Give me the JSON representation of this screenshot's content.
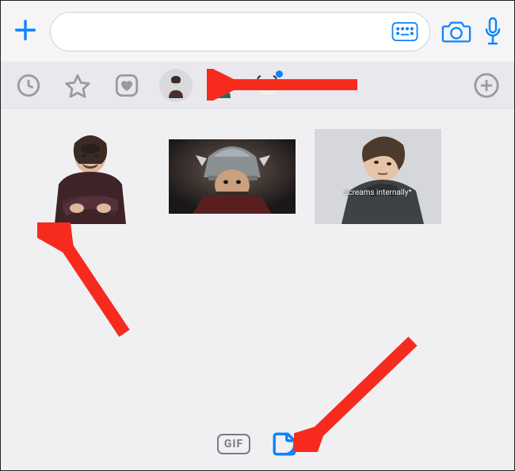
{
  "compose": {
    "plus_label": "+",
    "input_value": "",
    "input_placeholder": ""
  },
  "tabs": {
    "items": [
      {
        "name": "recents-tab",
        "icon": "clock"
      },
      {
        "name": "favorites-tab",
        "icon": "star"
      },
      {
        "name": "heart-pack-tab",
        "icon": "heart-square"
      },
      {
        "name": "sticker-pack-1-tab",
        "icon": "avatar-1",
        "selected": true
      },
      {
        "name": "sticker-pack-2-tab",
        "icon": "avatar-2"
      },
      {
        "name": "sticker-pack-3-tab",
        "icon": "avatar-3",
        "has_update": true
      }
    ],
    "add_label": "+"
  },
  "stickers": [
    {
      "name": "sticker-1",
      "caption": ""
    },
    {
      "name": "sticker-2",
      "caption": ""
    },
    {
      "name": "sticker-3",
      "caption": "screams internally*"
    }
  ],
  "bottom": {
    "gif_label": "GIF",
    "sticker_selected": true
  },
  "annotations": {
    "arrow_1_target": "sticker-pack-1-tab",
    "arrow_2_target": "sticker-1",
    "arrow_3_target": "sticker-chip"
  },
  "colors": {
    "accent": "#0a84ff",
    "annotation": "#f62b1d"
  }
}
